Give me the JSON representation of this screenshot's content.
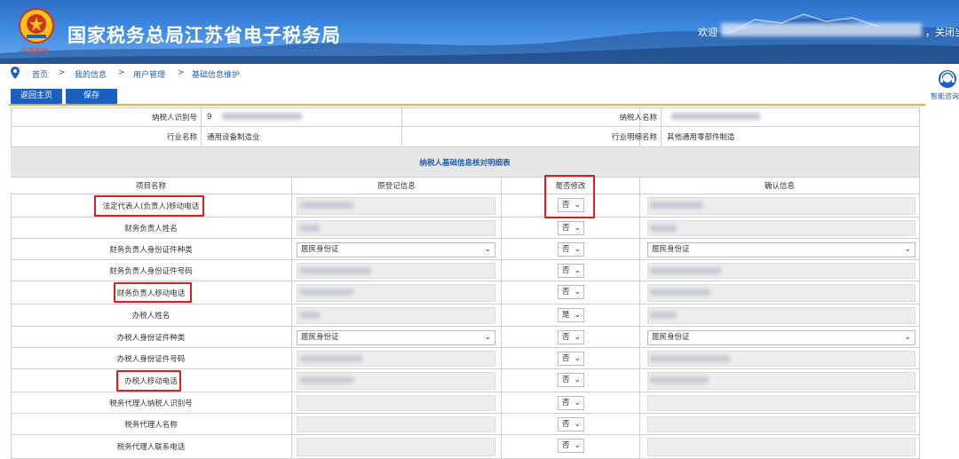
{
  "header": {
    "title": "国家税务总局江苏省电子税务局",
    "logo_caption": "中国税务",
    "welcome": "欢迎",
    "logout": "，关闭当页"
  },
  "breadcrumb": {
    "items": [
      "首页",
      "我的信息",
      "用户管理",
      "基础信息维护"
    ],
    "separator": ">"
  },
  "toolbar": {
    "home_button": "返回主页",
    "save_button": "保存"
  },
  "assistant": {
    "label": "智能咨询"
  },
  "taxpayer": {
    "id_label": "纳税人识别号",
    "id_value": "9",
    "name_label": "纳税人名称",
    "industry_label": "行业名称",
    "industry_value": "通用设备制造业",
    "industry_detail_label": "行业明细名称",
    "industry_detail_value": "其他通用零部件制造"
  },
  "detail_table": {
    "section_title": "纳税人基础信息核对明细表",
    "columns": [
      "项目名称",
      "原登记信息",
      "是否修改",
      "确认信息"
    ],
    "rows": [
      {
        "name": "法定代表人(负责人)移动电话",
        "original": "",
        "modified": "否",
        "confirm": ""
      },
      {
        "name": "财务负责人姓名",
        "original": "",
        "modified": "否",
        "confirm": ""
      },
      {
        "name": "财务负责人身份证件种类",
        "original": "居民身份证",
        "modified": "否",
        "confirm": "居民身份证"
      },
      {
        "name": "财务负责人身份证件号码",
        "original": "",
        "modified": "否",
        "confirm": ""
      },
      {
        "name": "财务负责人移动电话",
        "original": "",
        "modified": "否",
        "confirm": ""
      },
      {
        "name": "办税人姓名",
        "original": "",
        "modified": "是",
        "confirm": ""
      },
      {
        "name": "办税人身份证件种类",
        "original": "居民身份证",
        "modified": "否",
        "confirm": "居民身份证"
      },
      {
        "name": "办税人身份证件号码",
        "original": "",
        "modified": "否",
        "confirm": ""
      },
      {
        "name": "办税人移动电话",
        "original": "",
        "modified": "否",
        "confirm": ""
      },
      {
        "name": "税务代理人纳税人识别号",
        "original": "",
        "modified": "否",
        "confirm": ""
      },
      {
        "name": "税务代理人名称",
        "original": "",
        "modified": "否",
        "confirm": ""
      },
      {
        "name": "税务代理人联系电话",
        "original": "",
        "modified": "否",
        "confirm": ""
      }
    ]
  },
  "colors": {
    "brand_blue": "#1b5fc0",
    "highlight_red": "#e21c1c",
    "toolbar_line": "#f3a93c"
  }
}
